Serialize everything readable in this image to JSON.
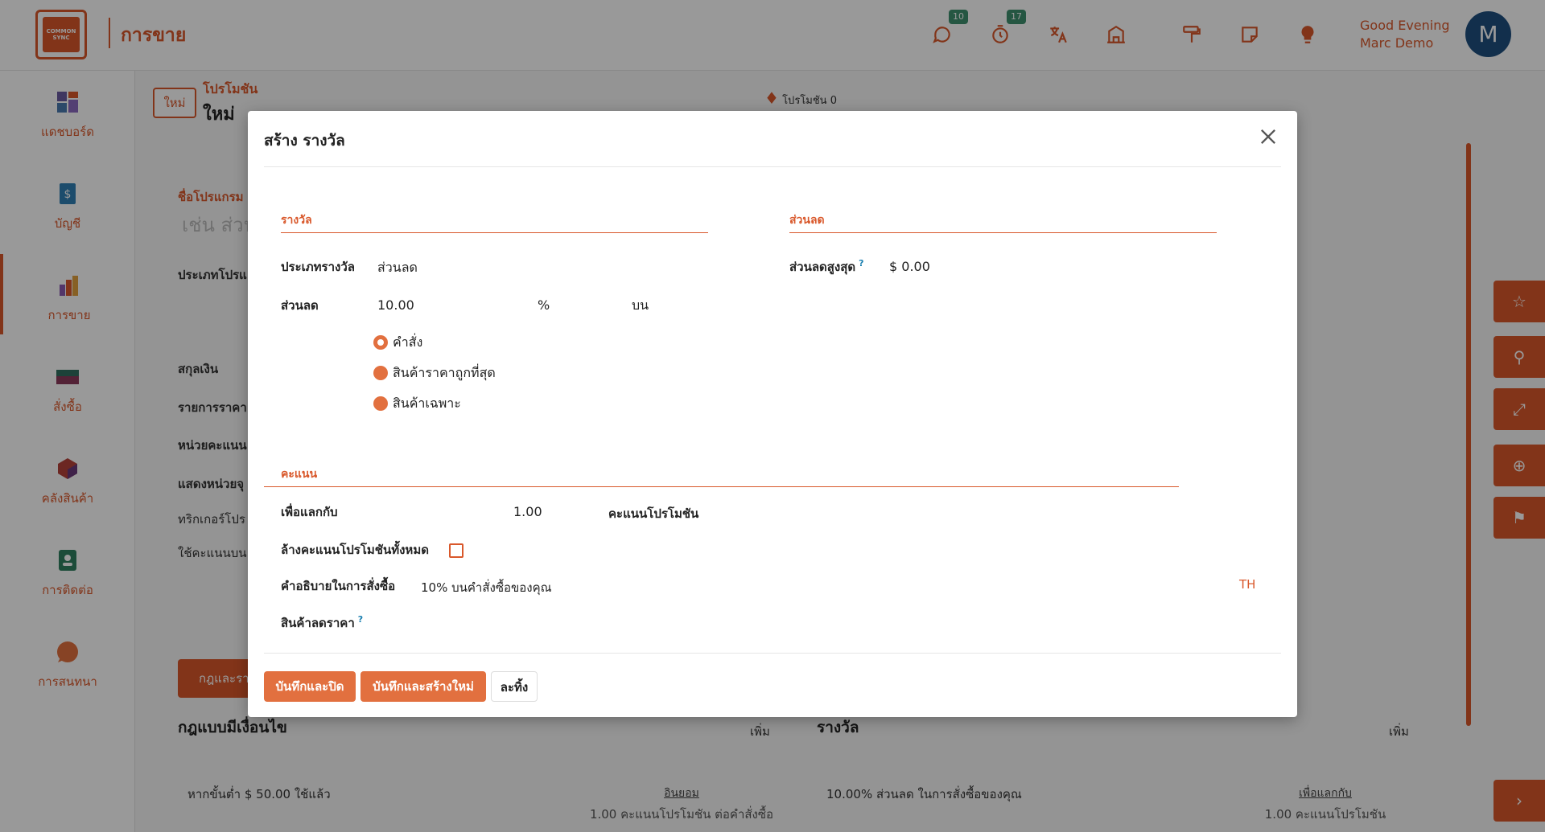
{
  "brand": {
    "logo_text": "COMMON SYNC",
    "app_title": "การขาย"
  },
  "topbar": {
    "chat_badge": "10",
    "activity_badge": "17",
    "greeting_line1": "Good Evening",
    "greeting_line2": "Marc Demo",
    "avatar_initial": "M"
  },
  "sidebar": {
    "items": [
      {
        "label": "แดชบอร์ด",
        "icon": "dashboard-icon",
        "color": "#5a5a9a"
      },
      {
        "label": "บัญชี",
        "icon": "accounting-icon",
        "color": "#2f7fb4"
      },
      {
        "label": "การขาย",
        "icon": "sales-icon",
        "color": "#d9582b"
      },
      {
        "label": "สั่งซื้อ",
        "icon": "purchase-icon",
        "color": "#2f6f5f"
      },
      {
        "label": "คลังสินค้า",
        "icon": "inventory-icon",
        "color": "#b4413a"
      },
      {
        "label": "การติดต่อ",
        "icon": "contacts-icon",
        "color": "#2f7f5f"
      },
      {
        "label": "การสนทนา",
        "icon": "discuss-icon",
        "color": "#e2703f"
      }
    ]
  },
  "background": {
    "new_button": "ใหม่",
    "breadcrumb_parent": "โปรโมชัน",
    "breadcrumb_current": "ใหม่",
    "smart_button": "โปรโมชัน",
    "smart_button_count": "0",
    "program_name_label": "ชื่อโปรแกรม",
    "program_name_placeholder": "เช่น ส่วน",
    "program_type_label": "ประเภทโปรแ",
    "currency_label": "สกุลเงิน",
    "pricelist_label": "รายการราคา",
    "points_unit_label": "หน่วยคะแนน",
    "show_points_label": "แสดงหน่วยจุ",
    "trigger_label": "ทริกเกอร์โปร",
    "use_points_label": "ใช้คะแนนบน",
    "rules_button": "กฎและรา",
    "rules_heading": "กฎแบบมีเงื่อนไข",
    "rewards_heading": "รางวัล",
    "add_left": "เพิ่ม",
    "add_right": "เพิ่ม",
    "rule_condition": "หากขั้นต่ำ $ 50.00 ใช้แล้ว",
    "rule_link": "อินยอม",
    "rule_points": "1.00 คะแนนโปรโมชัน ต่อคำสั่งซื้อ",
    "reward_desc": "10.00% ส่วนลด ในการสั่งซื้อของคุณ",
    "reward_link": "เพื่อแลกกับ",
    "reward_points": "1.00 คะแนนโปรโมชัน"
  },
  "modal": {
    "title": "สร้าง รางวัล",
    "reward_section": "รางวัล",
    "discount_section": "ส่วนลด",
    "reward_type_label": "ประเภทรางวัล",
    "reward_type_value": "ส่วนลด",
    "discount_label": "ส่วนลด",
    "discount_value": "10.00",
    "discount_unit": "%",
    "on_label": "บน",
    "apply_on_options": [
      {
        "label": "คำสั่ง",
        "checked": true
      },
      {
        "label": "สินค้าราคาถูกที่สุด",
        "checked": false
      },
      {
        "label": "สินค้าเฉพาะ",
        "checked": false
      }
    ],
    "max_discount_label": "ส่วนลดสูงสุด",
    "max_discount_help": "?",
    "max_discount_value": "$ 0.00",
    "points_section": "คะแนน",
    "in_exchange_label": "เพื่อแลกกับ",
    "in_exchange_value": "1.00",
    "in_exchange_unit": "คะแนนโปรโมชัน",
    "clear_points_label": "ล้างคะแนนโปรโมชันทั้งหมด",
    "clear_points_checked": false,
    "description_label": "คำอธิบายในการสั่งซื้อ",
    "description_value": "10% บนคำสั่งซื้อของคุณ",
    "language_code": "TH",
    "discount_product_label": "สินค้าลดราคา",
    "discount_product_help": "?",
    "buttons": {
      "save_close": "บันทึกและปิด",
      "save_new": "บันทึกและสร้างใหม่",
      "discard": "ละทิ้ง"
    }
  },
  "colors": {
    "accent": "#d9582b",
    "accent_light": "#e2703f",
    "badge": "#3f8f6f",
    "avatar": "#1f4f7f"
  }
}
